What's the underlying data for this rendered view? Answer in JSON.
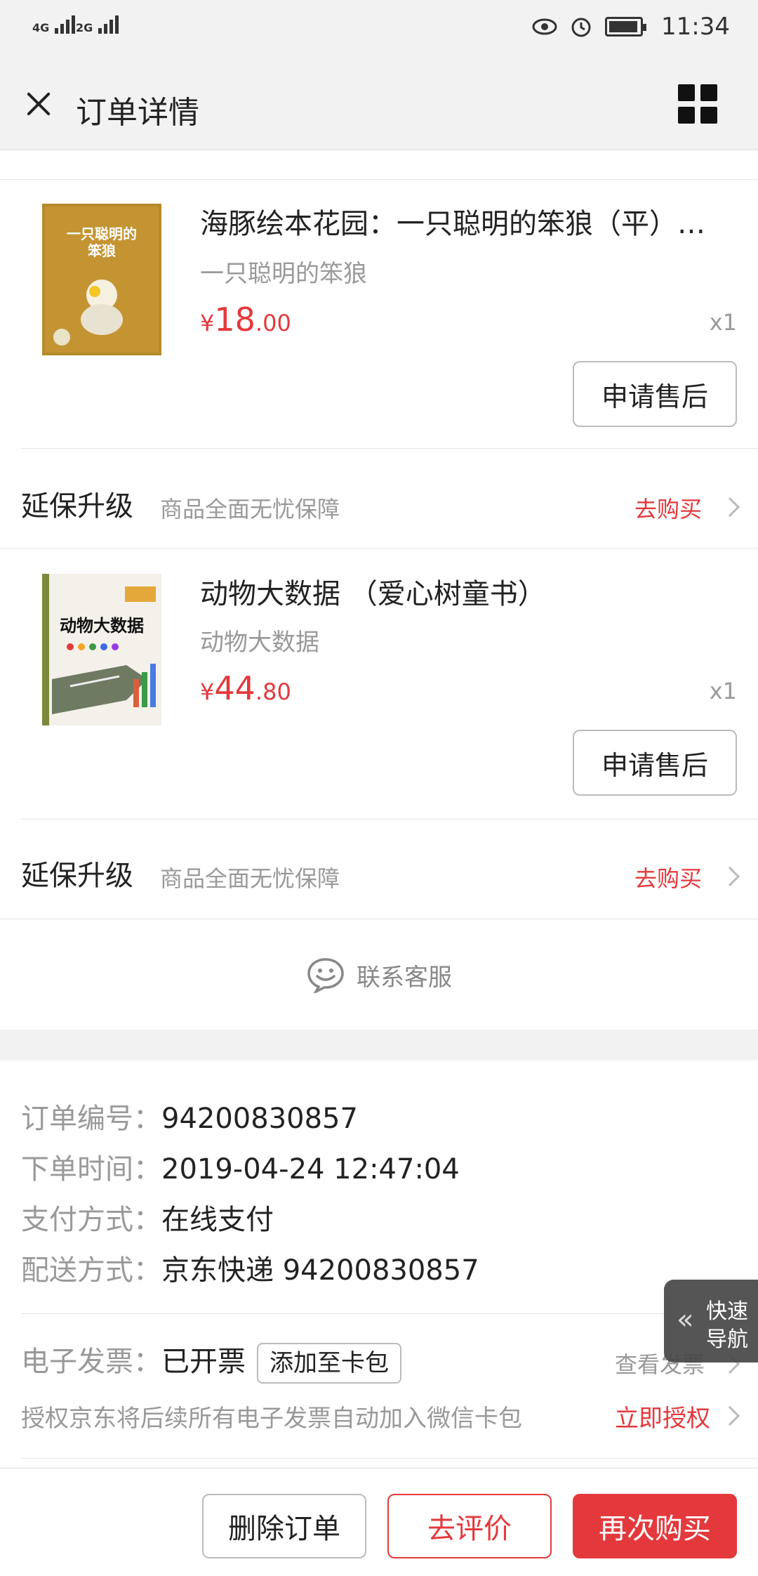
{
  "status_bar": {
    "sim1": "4G",
    "sim2": "2G",
    "time": "11:34"
  },
  "header": {
    "title": "订单详情"
  },
  "products": [
    {
      "name": "海豚绘本花园：一只聪明的笨狼（平）…",
      "subtitle": "一只聪明的笨狼",
      "currency": "¥",
      "price_int": "18",
      "price_dec": ".00",
      "qty": "x1",
      "after_sale": "申请售后",
      "cover_text": "一只聪明的笨狼"
    },
    {
      "name": "动物大数据 （爱心树童书）",
      "subtitle": "动物大数据",
      "currency": "¥",
      "price_int": "44",
      "price_dec": ".80",
      "qty": "x1",
      "after_sale": "申请售后",
      "cover_text": "动物大数据"
    }
  ],
  "warranty": {
    "title": "延保升级",
    "desc": "商品全面无忧保障",
    "link": "去购买"
  },
  "service": {
    "label": "联系客服"
  },
  "order_info": {
    "number_label": "订单编号：",
    "number": "94200830857",
    "time_label": "下单时间：",
    "time": "2019-04-24 12:47:04",
    "pay_label": "支付方式：",
    "pay": "在线支付",
    "ship_label": "配送方式：",
    "ship": "京东快递 94200830857"
  },
  "invoice": {
    "label": "电子发票：",
    "status": "已开票",
    "add_card": "添加至卡包",
    "view": "查看发票",
    "auth_text": "授权京东将后续所有电子发票自动加入微信卡包",
    "auth_link": "立即授权"
  },
  "quick_nav": {
    "line1": "快速",
    "line2": "导航"
  },
  "bottom_bar": {
    "delete": "删除订单",
    "review": "去评价",
    "rebuy": "再次购买"
  },
  "colors": {
    "accent": "#e4393c",
    "header_bg": "#f2f2f2",
    "muted_text": "#999999"
  }
}
